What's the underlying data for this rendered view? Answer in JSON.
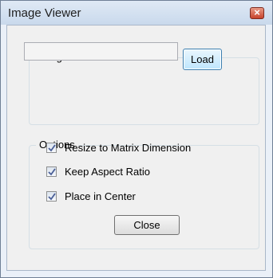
{
  "window": {
    "title": "Image Viewer"
  },
  "image_file": {
    "group_label": "Image-File",
    "path_value": "",
    "load_label": "Load"
  },
  "options": {
    "group_label": "Options",
    "items": [
      {
        "label": "Resize to Matrix Dimension",
        "checked": true
      },
      {
        "label": "Keep Aspect Ratio",
        "checked": true
      },
      {
        "label": "Place in Center",
        "checked": true
      }
    ]
  },
  "footer": {
    "close_label": "Close"
  },
  "colors": {
    "accent": "#3c7fb1",
    "close_red": "#c7432b"
  },
  "icons": {
    "window_close": "close-icon",
    "check": "check-icon"
  }
}
